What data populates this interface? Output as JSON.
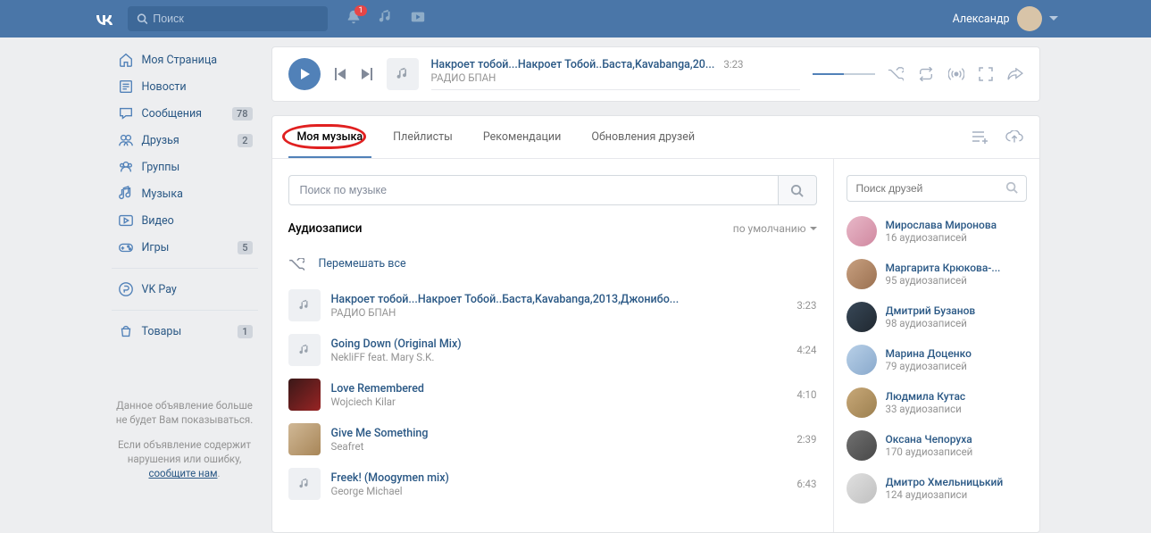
{
  "search_placeholder": "Поиск",
  "user_name": "Александр",
  "notif_badge": "1",
  "nav": [
    {
      "label": "Моя Страница",
      "icon": "home"
    },
    {
      "label": "Новости",
      "icon": "news"
    },
    {
      "label": "Сообщения",
      "icon": "msg",
      "count": "78"
    },
    {
      "label": "Друзья",
      "icon": "friends",
      "count": "2"
    },
    {
      "label": "Группы",
      "icon": "groups"
    },
    {
      "label": "Музыка",
      "icon": "music"
    },
    {
      "label": "Видео",
      "icon": "video"
    },
    {
      "label": "Игры",
      "icon": "games",
      "count": "5"
    }
  ],
  "nav2": [
    {
      "label": "VK Pay",
      "icon": "pay"
    }
  ],
  "nav3": [
    {
      "label": "Товары",
      "icon": "goods",
      "count": "1"
    }
  ],
  "ad": {
    "line1": "Данное объявление больше не будет Вам показываться.",
    "line2_a": "Если объявление содержит нарушения или ошибку, ",
    "line2_link": "сообщите нам",
    "line2_b": "."
  },
  "player": {
    "title": "Накроет тобой...Накроет Тобой..Баста,Kavabanga,20...",
    "artist": "РАДИО БПАН",
    "duration": "3:23"
  },
  "tabs": [
    "Моя музыка",
    "Плейлисты",
    "Рекомендации",
    "Обновления друзей"
  ],
  "music_search_placeholder": "Поиск по музыке",
  "section_title": "Аудиозаписи",
  "sort_label": "по умолчанию",
  "shuffle_label": "Перемешать все",
  "tracks": [
    {
      "title": "Накроет тобой...Накроет Тобой..Баста,Kavabanga,2013,Джонибо...",
      "artist": "РАДИО БПАН",
      "duration": "3:23",
      "art": ""
    },
    {
      "title": "Going Down (Original Mix)",
      "artist": "NekliFF feat. Mary S.K.",
      "duration": "4:24",
      "art": ""
    },
    {
      "title": "Love Remembered",
      "artist": "Wojciech Kilar",
      "duration": "4:10",
      "art": "img1"
    },
    {
      "title": "Give Me Something",
      "artist": "Seafret",
      "duration": "2:39",
      "art": "img2"
    },
    {
      "title": "Freek! (Moogymen mix)",
      "artist": "George Michael",
      "duration": "6:43",
      "art": ""
    }
  ],
  "friend_search_placeholder": "Поиск друзей",
  "friends": [
    {
      "name": "Мирослава Миронова",
      "count": "16 аудиозаписей",
      "cls": "fa1"
    },
    {
      "name": "Маргарита Крюкова-...",
      "count": "95 аудиозаписей",
      "cls": "fa2"
    },
    {
      "name": "Дмитрий Бузанов",
      "count": "98 аудиозаписей",
      "cls": "fa3"
    },
    {
      "name": "Марина Доценко",
      "count": "79 аудиозаписей",
      "cls": "fa4"
    },
    {
      "name": "Людмила Кутас",
      "count": "33 аудиозаписи",
      "cls": "fa5"
    },
    {
      "name": "Оксана Чепоруха",
      "count": "170 аудиозаписей",
      "cls": "fa6"
    },
    {
      "name": "Дмитро Хмельницький",
      "count": "124 аудиозаписи",
      "cls": "fa7"
    }
  ]
}
